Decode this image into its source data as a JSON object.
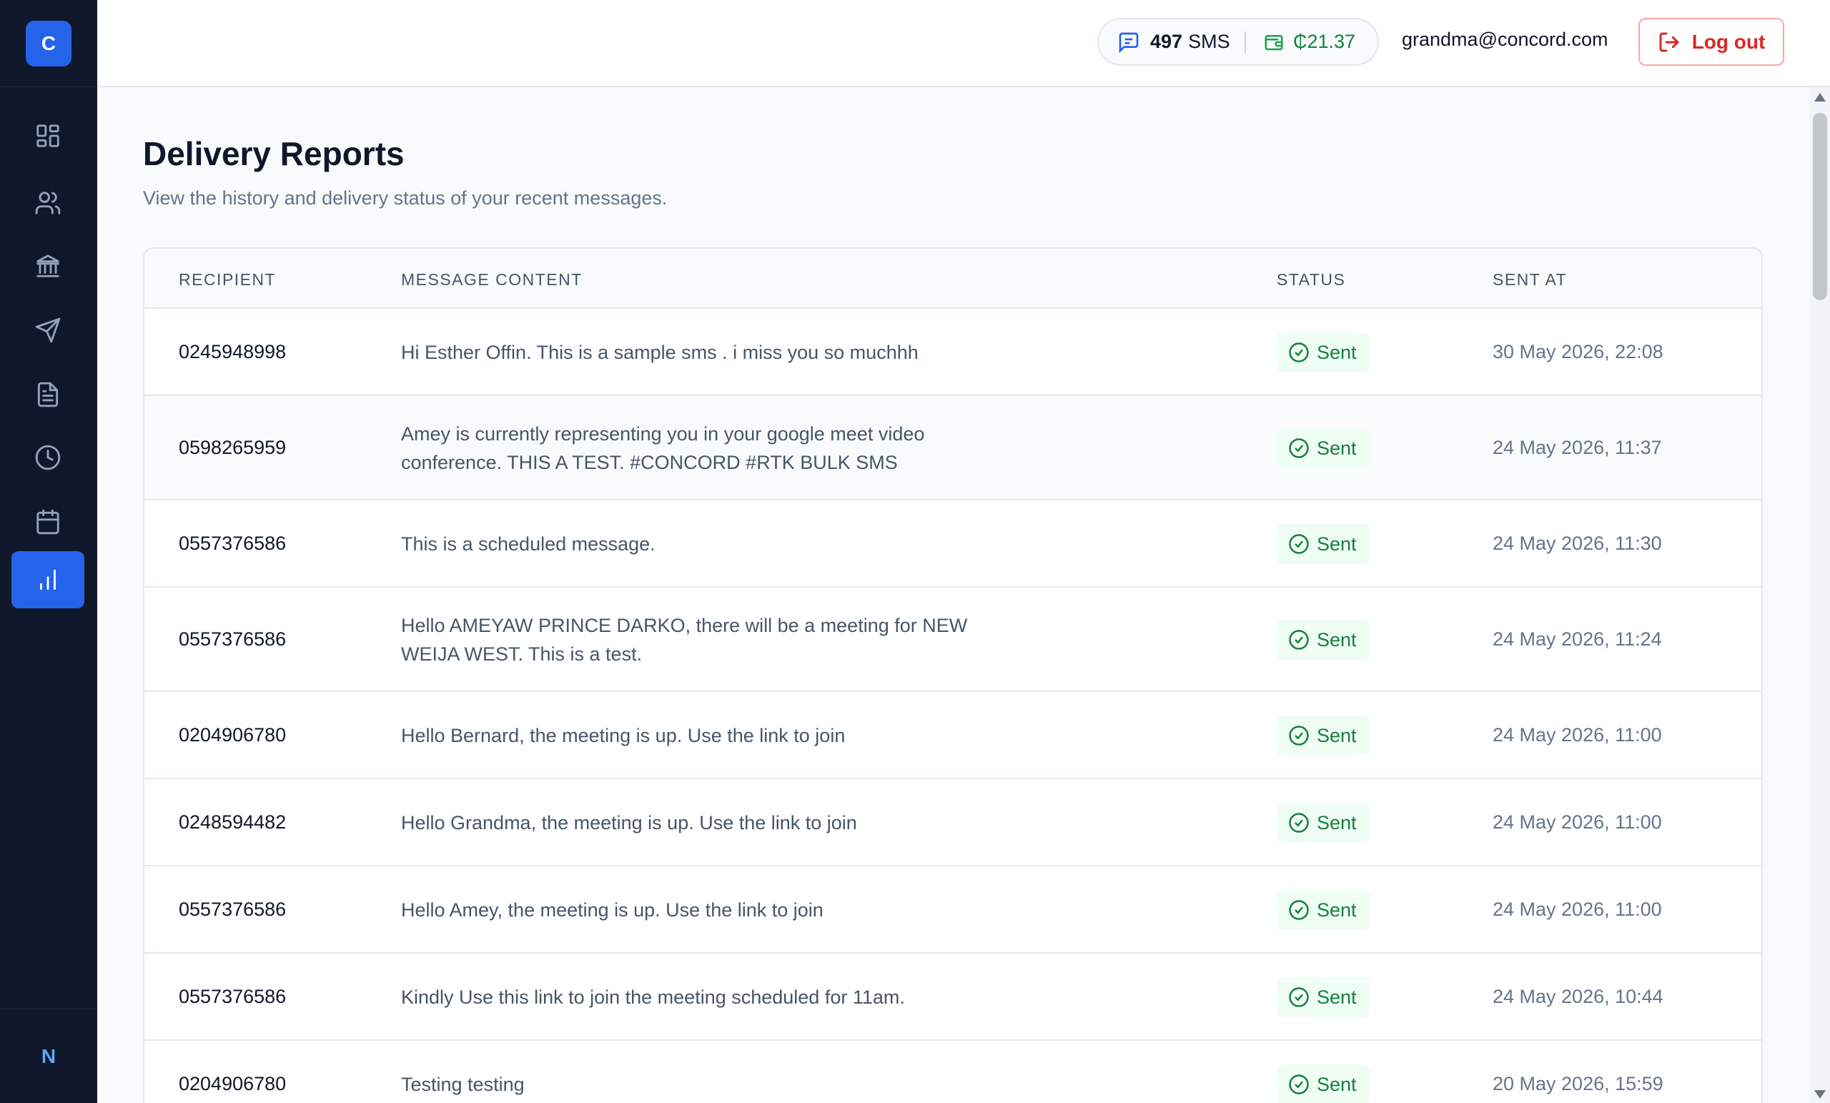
{
  "brand": {
    "logo_letter": "C"
  },
  "sidebar": {
    "items": [
      {
        "name": "dashboard",
        "icon": "grid-icon"
      },
      {
        "name": "contacts",
        "icon": "users-icon"
      },
      {
        "name": "billing",
        "icon": "bank-icon"
      },
      {
        "name": "send-sms",
        "icon": "send-icon"
      },
      {
        "name": "templates",
        "icon": "document-icon"
      },
      {
        "name": "history",
        "icon": "clock-icon"
      },
      {
        "name": "scheduled",
        "icon": "calendar-icon"
      },
      {
        "name": "reports",
        "icon": "bar-chart-icon",
        "active": true
      }
    ],
    "footer_letter": "N"
  },
  "header": {
    "sms_count": "497",
    "sms_unit": "SMS",
    "balance": "₵21.37",
    "user_email": "grandma@concord.com",
    "logout_label": "Log out"
  },
  "page": {
    "title": "Delivery Reports",
    "subtitle": "View the history and delivery status of your recent messages."
  },
  "table": {
    "headers": [
      "RECIPIENT",
      "MESSAGE CONTENT",
      "STATUS",
      "SENT AT"
    ],
    "rows": [
      {
        "recipient": "0245948998",
        "content": "Hi Esther Offin. This is a sample sms . i miss you so muchhh",
        "status": "Sent",
        "sent_at": "30 May 2026, 22:08"
      },
      {
        "recipient": "0598265959",
        "content": "Amey is currently representing you in your google meet video conference. THIS A TEST. #CONCORD #RTK BULK SMS",
        "status": "Sent",
        "sent_at": "24 May 2026, 11:37"
      },
      {
        "recipient": "0557376586",
        "content": "This is a scheduled message.",
        "status": "Sent",
        "sent_at": "24 May 2026, 11:30"
      },
      {
        "recipient": "0557376586",
        "content": "Hello AMEYAW PRINCE DARKO, there will be a meeting for NEW WEIJA WEST. This is a test.",
        "status": "Sent",
        "sent_at": "24 May 2026, 11:24"
      },
      {
        "recipient": "0204906780",
        "content": "Hello Bernard, the meeting is up. Use the link to join",
        "status": "Sent",
        "sent_at": "24 May 2026, 11:00"
      },
      {
        "recipient": "0248594482",
        "content": "Hello Grandma, the meeting is up. Use the link to join",
        "status": "Sent",
        "sent_at": "24 May 2026, 11:00"
      },
      {
        "recipient": "0557376586",
        "content": "Hello Amey, the meeting is up. Use the link to join",
        "status": "Sent",
        "sent_at": "24 May 2026, 11:00"
      },
      {
        "recipient": "0557376586",
        "content": "Kindly Use this link to join the meeting scheduled for 11am.",
        "status": "Sent",
        "sent_at": "24 May 2026, 10:44"
      },
      {
        "recipient": "0204906780",
        "content": "Testing testing",
        "status": "Sent",
        "sent_at": "20 May 2026, 15:59"
      }
    ]
  },
  "colors": {
    "accent": "#2563eb",
    "sidebar_bg": "#0f172a",
    "success": "#15803d",
    "danger": "#dc2626"
  }
}
